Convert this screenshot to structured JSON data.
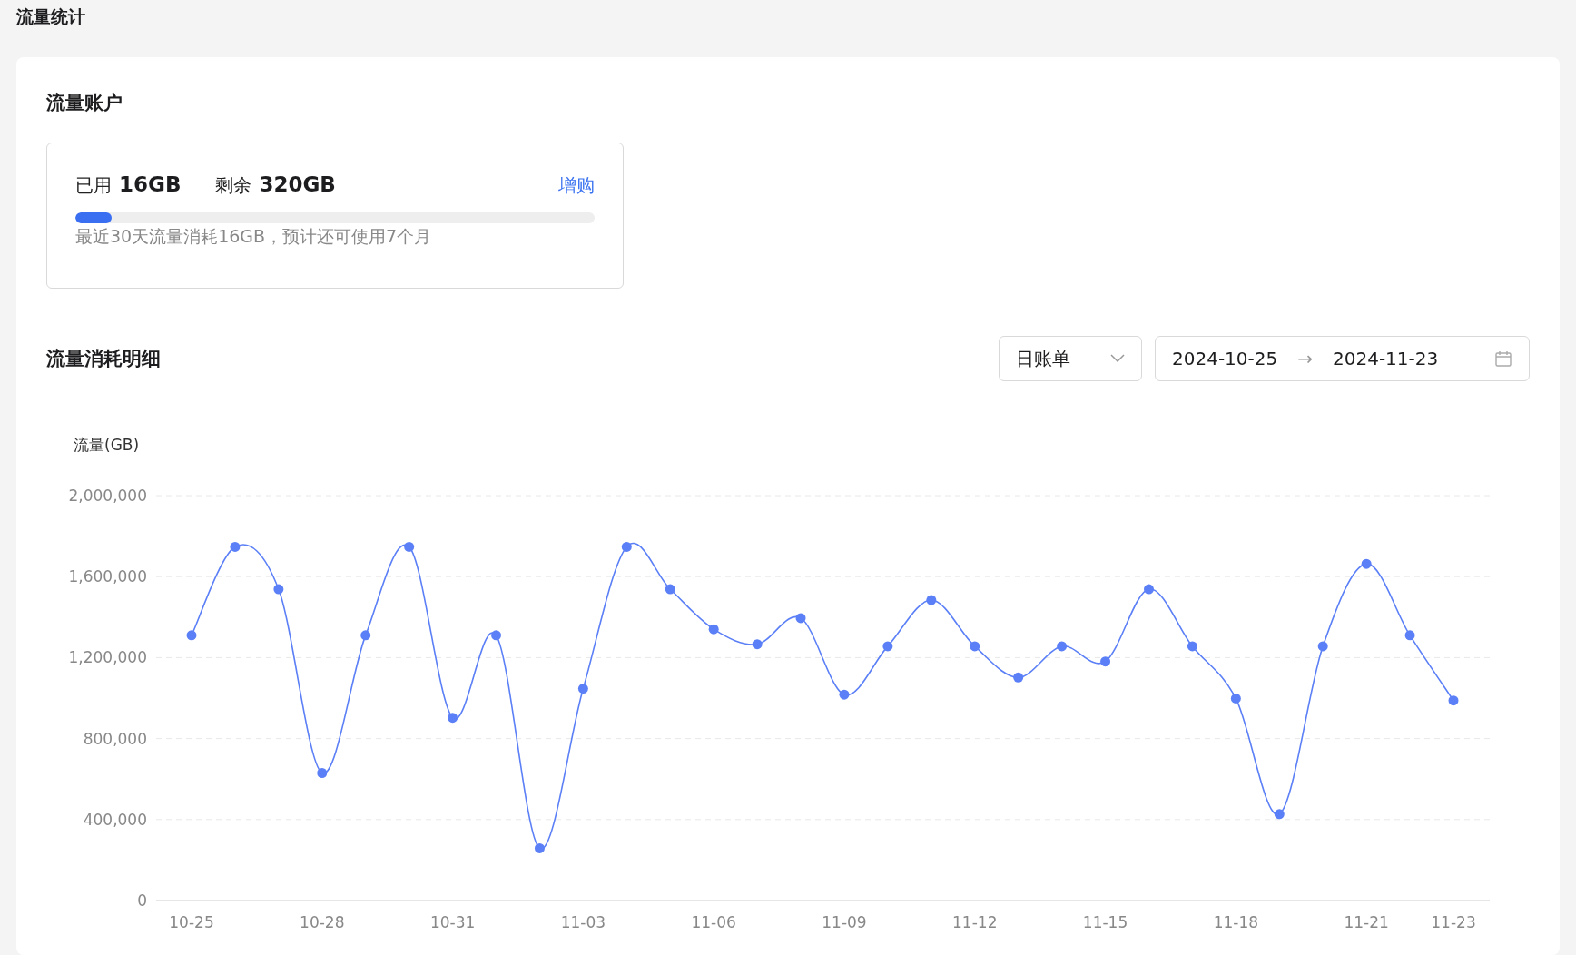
{
  "page_title": "流量统计",
  "account": {
    "title": "流量账户",
    "used_label": "已用",
    "used_value": "16GB",
    "remaining_label": "剩余",
    "remaining_value": "320GB",
    "buy_link": "增购",
    "level": 0.07,
    "note": "最近30天流量消耗16GB，预计还可使用7个月"
  },
  "details": {
    "title": "流量消耗明细",
    "period_select": {
      "value": "日账单"
    },
    "date_range": {
      "start": "2024-10-25",
      "separator": "→",
      "end": "2024-11-23"
    },
    "chart_data": {
      "type": "line",
      "ylabel": "流量(GB)",
      "categories": [
        "10-25",
        null,
        null,
        "10-28",
        null,
        null,
        "10-31",
        null,
        null,
        "11-03",
        null,
        null,
        "11-06",
        null,
        null,
        "11-09",
        null,
        null,
        "11-12",
        null,
        null,
        "11-15",
        null,
        null,
        "11-18",
        null,
        null,
        "11-21",
        null,
        "11-23"
      ],
      "grid": true,
      "series": [
        {
          "color": "#5b7ff6",
          "marker": "circle",
          "values": [
            1310000,
            1747000,
            1538000,
            630000,
            1310000,
            1747000,
            903000,
            1310000,
            258000,
            1047000,
            1747000,
            1538000,
            1340000,
            1266000,
            1395000,
            1017000,
            1256000,
            1484000,
            1256000,
            1102000,
            1256000,
            1181000,
            1538000,
            1256000,
            998000,
            427000,
            1256000,
            1663000,
            1310000,
            988000
          ]
        }
      ],
      "ylim": [
        0,
        2000000
      ],
      "yticks": [
        {
          "value": 0,
          "label": "0"
        },
        {
          "value": 400000,
          "label": "400,000"
        },
        {
          "value": 800000,
          "label": "800,000"
        },
        {
          "value": 1200000,
          "label": "1,200,000"
        },
        {
          "value": 1600000,
          "label": "1,600,000"
        },
        {
          "value": 2000000,
          "label": "2,000,000"
        }
      ]
    }
  }
}
